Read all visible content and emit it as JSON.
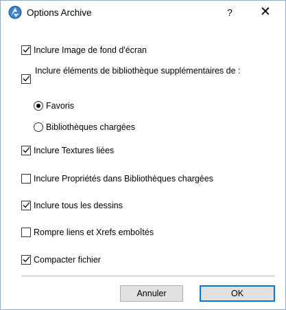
{
  "window": {
    "title": "Options Archive",
    "help_label": "?",
    "close_label": "✕",
    "app_icon": "archicad-logo-icon"
  },
  "options": {
    "include_background": {
      "label": "Inclure Image de fond d'écran",
      "checked": true
    },
    "include_library": {
      "label": "Inclure éléments de bibliothèque supplémentaires de :",
      "checked": true
    },
    "radio_favorites": {
      "label": "Favoris",
      "selected": true
    },
    "radio_loaded": {
      "label": "Bibliothèques chargées",
      "selected": false
    },
    "include_textures": {
      "label": "Inclure Textures liées",
      "checked": true
    },
    "include_properties": {
      "label": "Inclure Propriétés dans Bibliothèques chargées",
      "checked": false
    },
    "include_drawings": {
      "label": "Inclure tous les dessins",
      "checked": true
    },
    "break_links": {
      "label": "Rompre liens et Xrefs emboîtés",
      "checked": false
    },
    "compact_file": {
      "label": "Compacter fichier",
      "checked": true
    }
  },
  "buttons": {
    "cancel": "Annuler",
    "ok": "OK"
  },
  "colors": {
    "accent": "#0078d7",
    "border": "#8fa8c8"
  }
}
